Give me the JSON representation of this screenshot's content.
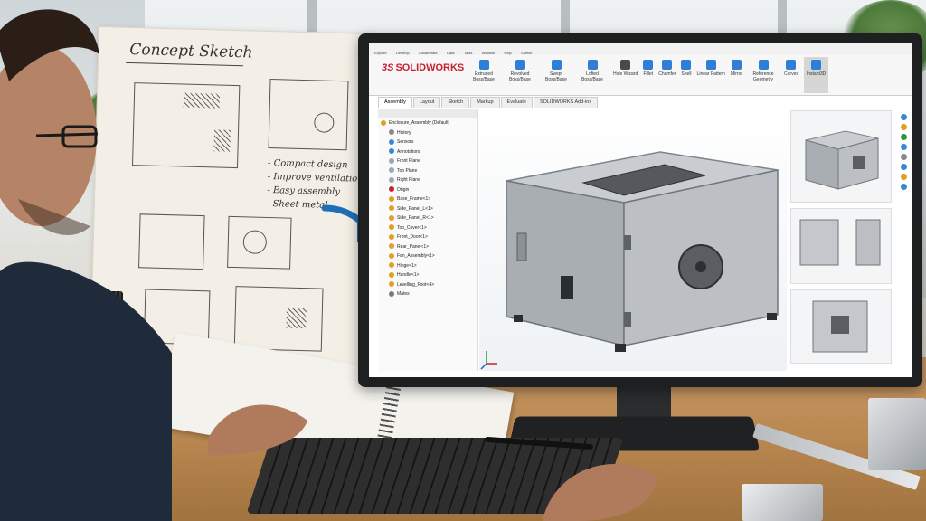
{
  "sketch": {
    "title": "Concept Sketch",
    "notes": [
      "- Compact design",
      "- Improve ventilation",
      "- Easy assembly",
      "- Sheet metal"
    ]
  },
  "app": {
    "logo": "SOLIDWORKS",
    "logo_mark": "3S",
    "accent": "#c8202f",
    "quick_access": [
      "Explore",
      "Develop",
      "Collaborate",
      "Data",
      "Tools",
      "Window",
      "Help",
      "Sketch"
    ],
    "ribbon": [
      {
        "label": "Extruded Boss/Base",
        "icon": "extrude-icon",
        "color": "#2f7fd6"
      },
      {
        "label": "Revolved Boss/Base",
        "icon": "revolve-icon",
        "color": "#2f7fd6"
      },
      {
        "label": "Swept Boss/Base",
        "icon": "sweep-icon",
        "color": "#2f7fd6"
      },
      {
        "label": "Lofted Boss/Base",
        "icon": "loft-icon",
        "color": "#2f7fd6"
      },
      {
        "label": "Hole Wizard",
        "icon": "hole-icon",
        "color": "#4a4a4a"
      },
      {
        "label": "Fillet",
        "icon": "fillet-icon",
        "color": "#2f7fd6"
      },
      {
        "label": "Chamfer",
        "icon": "chamfer-icon",
        "color": "#2f7fd6"
      },
      {
        "label": "Shell",
        "icon": "shell-icon",
        "color": "#2f7fd6"
      },
      {
        "label": "Linear Pattern",
        "icon": "pattern-icon",
        "color": "#2f7fd6"
      },
      {
        "label": "Mirror",
        "icon": "mirror-icon",
        "color": "#2f7fd6"
      },
      {
        "label": "Reference Geometry",
        "icon": "reference-icon",
        "color": "#2f7fd6"
      },
      {
        "label": "Curves",
        "icon": "curves-icon",
        "color": "#2f7fd6"
      },
      {
        "label": "Instant3D",
        "icon": "instant3d-icon",
        "color": "#2f7fd6"
      }
    ],
    "tabs": [
      "Assembly",
      "Layout",
      "Sketch",
      "Markup",
      "Evaluate",
      "SOLIDWORKS Add-ins"
    ],
    "active_tab": "Assembly",
    "tree": [
      {
        "label": "Enclosure_Assembly (Default)",
        "icon": "assembly-icon",
        "color": "#e0a020"
      },
      {
        "label": "History",
        "icon": "history-icon",
        "color": "#8a8a8a"
      },
      {
        "label": "Sensors",
        "icon": "sensor-icon",
        "color": "#3a86d8"
      },
      {
        "label": "Annotations",
        "icon": "annotation-icon",
        "color": "#3a86d8"
      },
      {
        "label": "Front Plane",
        "icon": "plane-icon",
        "color": "#9aa7b4"
      },
      {
        "label": "Top Plane",
        "icon": "plane-icon",
        "color": "#9aa7b4"
      },
      {
        "label": "Right Plane",
        "icon": "plane-icon",
        "color": "#9aa7b4"
      },
      {
        "label": "Origin",
        "icon": "origin-icon",
        "color": "#c8202f"
      },
      {
        "label": "Base_Frame<1>",
        "icon": "part-icon",
        "color": "#e0a020"
      },
      {
        "label": "Side_Panel_L<1>",
        "icon": "part-icon",
        "color": "#e0a020"
      },
      {
        "label": "Side_Panel_R<1>",
        "icon": "part-icon",
        "color": "#e0a020"
      },
      {
        "label": "Top_Cover<1>",
        "icon": "part-icon",
        "color": "#e0a020"
      },
      {
        "label": "Front_Door<1>",
        "icon": "part-icon",
        "color": "#e0a020"
      },
      {
        "label": "Rear_Panel<1>",
        "icon": "part-icon",
        "color": "#e0a020"
      },
      {
        "label": "Fan_Assembly<1>",
        "icon": "part-icon",
        "color": "#e0a020"
      },
      {
        "label": "Hinge<1>",
        "icon": "part-icon",
        "color": "#e0a020"
      },
      {
        "label": "Handle<1>",
        "icon": "part-icon",
        "color": "#e0a020"
      },
      {
        "label": "Levelling_Foot<4>",
        "icon": "part-icon",
        "color": "#e0a020"
      },
      {
        "label": "Mates",
        "icon": "mates-icon",
        "color": "#7a7a7a"
      }
    ]
  }
}
